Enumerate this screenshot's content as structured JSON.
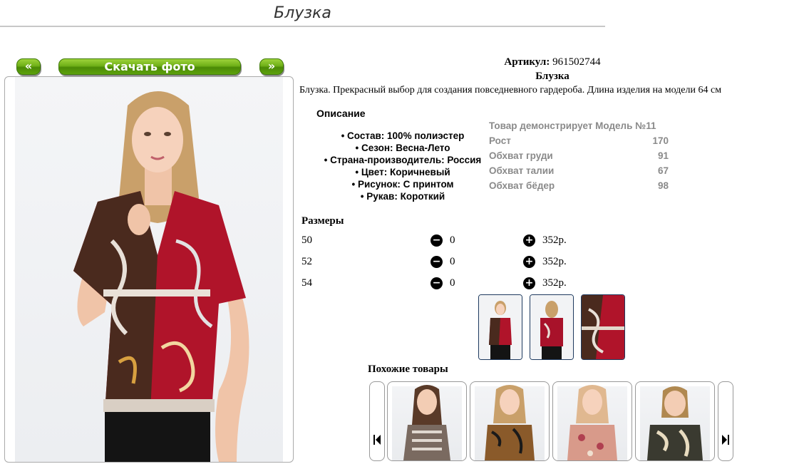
{
  "page": {
    "title": "Блузка"
  },
  "nav": {
    "prev_label": "«",
    "download_label": "Скачать фото",
    "next_label": "»"
  },
  "product": {
    "article_label": "Артикул:",
    "article_value": "961502744",
    "name": "Блузка",
    "description": "Блузка. Прекрасный выбор для создания повседневного гардероба. Длина изделия на модели 64 см"
  },
  "details": {
    "heading": "Описание",
    "features": [
      "• Состав: 100% полиэстер",
      "• Сезон: Весна-Лето",
      "• Страна-производитель: Россия",
      "• Цвет: Коричневый",
      "• Рисунок: С принтом",
      "• Рукав: Короткий"
    ]
  },
  "model": {
    "caption": "Товар демонстрирует Модель №11",
    "measurements": [
      {
        "label": "Рост",
        "value": "170"
      },
      {
        "label": "Обхват груди",
        "value": "91"
      },
      {
        "label": "Обхват талии",
        "value": "67"
      },
      {
        "label": "Обхват бёдер",
        "value": "98"
      }
    ]
  },
  "sizes": {
    "heading": "Размеры",
    "rows": [
      {
        "size": "50",
        "qty": "0",
        "price": "352р."
      },
      {
        "size": "52",
        "qty": "0",
        "price": "352р."
      },
      {
        "size": "54",
        "qty": "0",
        "price": "352р."
      }
    ]
  },
  "similar": {
    "heading": "Похожие товары"
  },
  "icons": {
    "minus": "minus-circle-icon",
    "plus": "plus-circle-icon",
    "carousel_prev": "skip-back-icon",
    "carousel_next": "skip-forward-icon"
  },
  "colors": {
    "button_green": "#6fb018",
    "thumb_border": "#1e3a5f",
    "blouse_red": "#b0142a",
    "blouse_brown": "#4a2a1e"
  }
}
